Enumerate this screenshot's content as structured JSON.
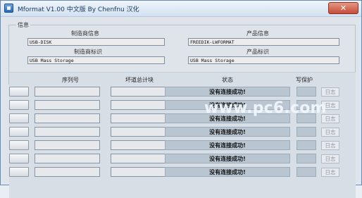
{
  "window": {
    "title": "Mformat V1.00 中文版 By Chenfnu 汉化",
    "close_label": "✕"
  },
  "info": {
    "legend": "信息",
    "manufacturer_info_label": "制造商信息",
    "manufacturer_info_value": "USB-DISK",
    "manufacturer_id_label": "制造商标识",
    "manufacturer_id_value": "USB Mass Storage",
    "product_info_label": "产品信息",
    "product_info_value": "FREEDIK-LWFORMAT",
    "product_id_label": "产品标识",
    "product_id_value": "USB Mass Storage"
  },
  "table": {
    "headers": {
      "serial": "序列号",
      "bad_blocks": "坏道总计块",
      "status": "状态",
      "write_protect": "写保护"
    },
    "rows": [
      {
        "status": "没有连接成功!",
        "log": "日志"
      },
      {
        "status": "没有连接成功!",
        "log": "日志"
      },
      {
        "status": "没有连接成功!",
        "log": "日志"
      },
      {
        "status": "没有连接成功!",
        "log": "日志"
      },
      {
        "status": "没有连接成功!",
        "log": "日志"
      },
      {
        "status": "没有连接成功!",
        "log": "日志"
      },
      {
        "status": "没有连接成功!",
        "log": "日志"
      }
    ]
  },
  "watermark": {
    "logo_text": "www.pc6.com"
  }
}
